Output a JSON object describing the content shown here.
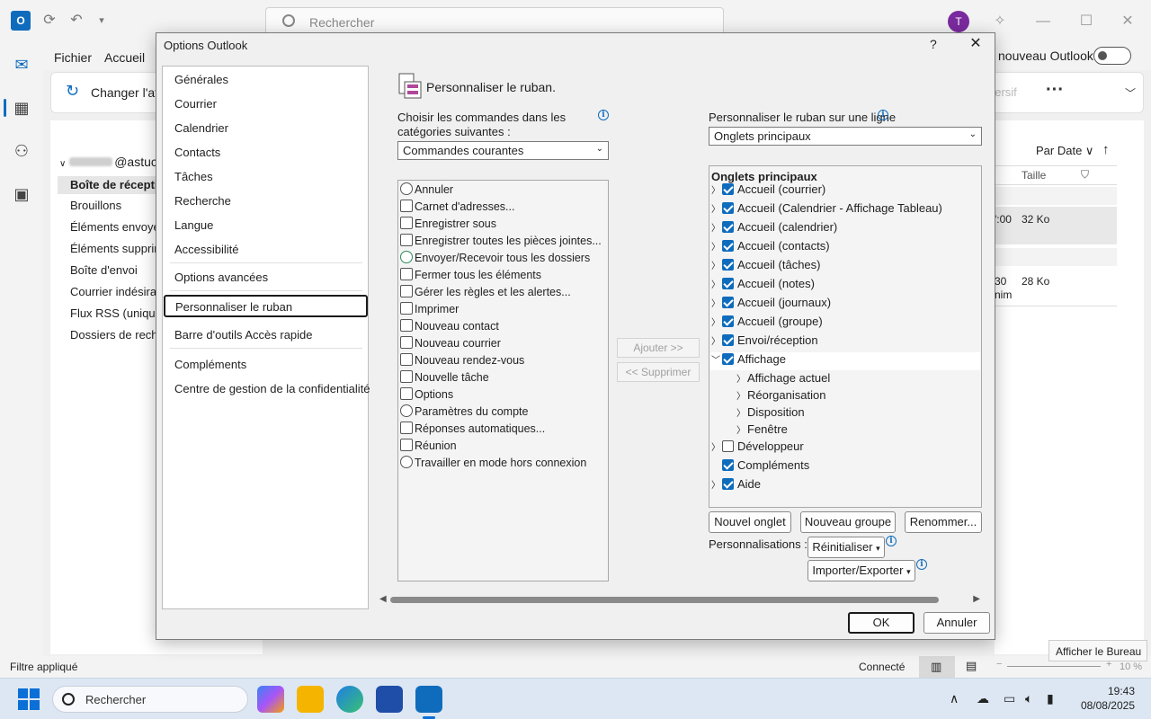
{
  "outlook": {
    "search_placeholder": "Rechercher",
    "avatar_initial": "T",
    "menu": [
      "Fichier",
      "Accueil"
    ],
    "new_outlook_label": "nouveau Outlook",
    "ribbon": {
      "changer": "Changer l'aff",
      "immersif": "nersif"
    },
    "account": "@astuc",
    "folders": [
      "Boîte de réception",
      "Brouillons",
      "Éléments envoyés",
      "Éléments supprim",
      "Boîte d'envoi",
      "Courrier indésirab",
      "Flux RSS (uniquem",
      "Dossiers de recher"
    ],
    "list": {
      "sort_label": "Par Date",
      "col_size": "Taille",
      "row1_time": "':00",
      "row1_size": "32 Ko",
      "row2_time": "30",
      "row2_sub": "nim",
      "row2_size": "28 Ko"
    },
    "status": {
      "filter": "Filtre appliqué",
      "connected": "Connecté",
      "zoom": "10 %"
    },
    "tooltip": "Afficher le Bureau"
  },
  "taskbar": {
    "search": "Rechercher",
    "time": "19:43",
    "date": "08/08/2025"
  },
  "dialog": {
    "title": "Options Outlook",
    "help": "?",
    "categories": [
      "Générales",
      "Courrier",
      "Calendrier",
      "Contacts",
      "Tâches",
      "Recherche",
      "Langue",
      "Accessibilité",
      "Options avancées",
      "Personnaliser le ruban",
      "Barre d'outils Accès rapide",
      "Compléments",
      "Centre de gestion de la confidentialité"
    ],
    "heading": "Personnaliser le ruban.",
    "left_label_1": "Choisir les commandes dans les",
    "left_label_2": "catégories suivantes :",
    "left_combo": "Commandes courantes",
    "right_label": "Personnaliser le ruban sur une ligne",
    "right_combo": "Onglets principaux",
    "commands": [
      "Annuler",
      "Carnet d'adresses...",
      "Enregistrer sous",
      "Enregistrer toutes les pièces jointes...",
      "Envoyer/Recevoir tous les dossiers",
      "Fermer tous les éléments",
      "Gérer les règles et les alertes...",
      "Imprimer",
      "Nouveau contact",
      "Nouveau courrier",
      "Nouveau rendez-vous",
      "Nouvelle tâche",
      "Options",
      "Paramètres du compte",
      "Réponses automatiques...",
      "Réunion",
      "Travailler en mode hors connexion"
    ],
    "add_button": "Ajouter >>",
    "remove_button": "<< Supprimer",
    "tree_title": "Onglets principaux",
    "tabs": [
      {
        "label": "Accueil (courrier)",
        "checked": true
      },
      {
        "label": "Accueil (Calendrier - Affichage Tableau)",
        "checked": true
      },
      {
        "label": "Accueil (calendrier)",
        "checked": true
      },
      {
        "label": "Accueil (contacts)",
        "checked": true
      },
      {
        "label": "Accueil (tâches)",
        "checked": true
      },
      {
        "label": "Accueil (notes)",
        "checked": true
      },
      {
        "label": "Accueil (journaux)",
        "checked": true
      },
      {
        "label": "Accueil (groupe)",
        "checked": true
      },
      {
        "label": "Envoi/réception",
        "checked": true
      },
      {
        "label": "Affichage",
        "checked": true,
        "expanded": true
      },
      {
        "label": "Affichage actuel"
      },
      {
        "label": "Réorganisation"
      },
      {
        "label": "Disposition"
      },
      {
        "label": "Fenêtre"
      },
      {
        "label": "Développeur",
        "checked": false
      },
      {
        "label": "Compléments",
        "checked": true
      },
      {
        "label": "Aide",
        "checked": true
      }
    ],
    "new_tab": "Nouvel onglet",
    "new_group": "Nouveau groupe",
    "rename": "Renommer...",
    "customizations_label": "Personnalisations :",
    "reset": "Réinitialiser",
    "import_export": "Importer/Exporter",
    "ok": "OK",
    "cancel": "Annuler"
  }
}
